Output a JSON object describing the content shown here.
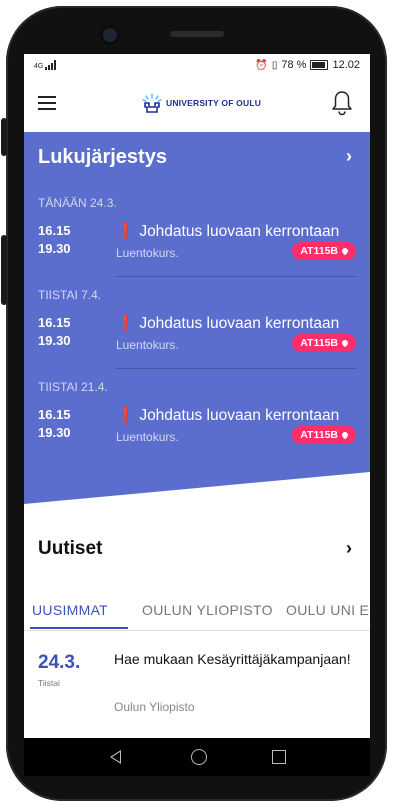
{
  "status": {
    "network": "4G",
    "battery_text": "78 %",
    "clock": "12.02"
  },
  "header": {
    "logo_text": "UNIVERSITY OF OULU",
    "brand_color": "#1f2f8f"
  },
  "schedule": {
    "title": "Lukujärjestys",
    "background": "#5b6dcd",
    "days": [
      {
        "label": "TÄNÄÄN 24.3.",
        "event": {
          "start": "16.15",
          "end": "19.30",
          "title": "Johdatus luovaan kerrontaan",
          "type": "Luentokurs.",
          "room": "AT115B"
        }
      },
      {
        "label": "TIISTAI 7.4.",
        "event": {
          "start": "16.15",
          "end": "19.30",
          "title": "Johdatus luovaan kerrontaan",
          "type": "Luentokurs.",
          "room": "AT115B"
        }
      },
      {
        "label": "TIISTAI 21.4.",
        "event": {
          "start": "16.15",
          "end": "19.30",
          "title": "Johdatus luovaan kerrontaan",
          "type": "Luentokurs.",
          "room": "AT115B"
        }
      }
    ]
  },
  "news": {
    "title": "Uutiset",
    "tabs": [
      {
        "label": "UUSIMMAT",
        "active": true
      },
      {
        "label": "OULUN YLIOPISTO",
        "active": false
      },
      {
        "label": "OULU UNI E",
        "active": false
      }
    ],
    "items": [
      {
        "date": "24.3.",
        "weekday": "Tiistai",
        "headline": "Hae mukaan Kesäyrittäjäkampanjaan!",
        "source": "Oulun Yliopisto"
      }
    ]
  },
  "colors": {
    "accent": "#3d51bd",
    "room_badge": "#ff2e6b"
  }
}
